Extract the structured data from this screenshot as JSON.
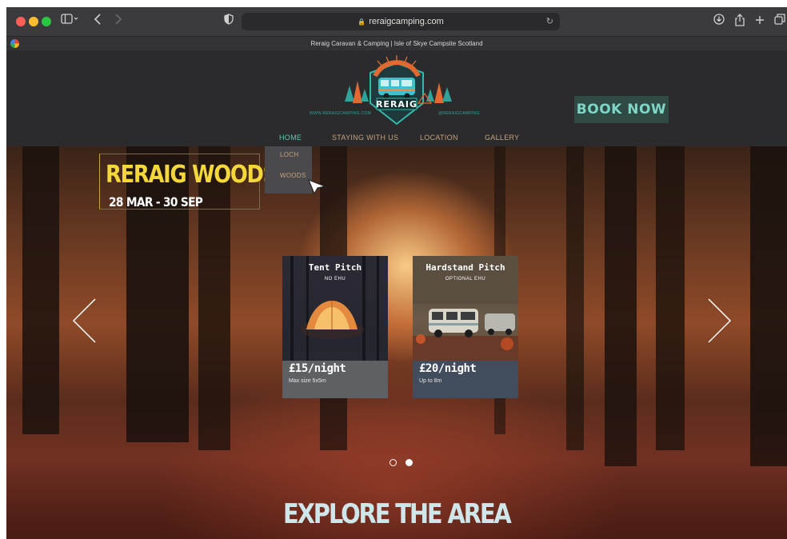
{
  "browser": {
    "url": "reraigcamping.com",
    "tab_title": "Reraig Caravan & Camping | Isle of Skye Campsite Scotland"
  },
  "header": {
    "logo_text": "RERAIG",
    "logo_website": "WWW.RERAIGCAMPING.COM",
    "logo_social": "@RERAIGCAMPING",
    "book_label": "BOOK NOW"
  },
  "nav": {
    "items": [
      "HOME",
      "STAYING WITH US",
      "LOCATION",
      "GALLERY"
    ],
    "active": "HOME",
    "dropdown": [
      "LOCH",
      "WOODS"
    ]
  },
  "hero": {
    "title": "RERAIG WOODS",
    "dates": "28 MAR - 30 SEP",
    "cards": [
      {
        "title": "Tent Pitch",
        "subtitle": "NO EHU",
        "price": "£15/night",
        "note": "Max size 5x5m"
      },
      {
        "title": "Hardstand Pitch",
        "subtitle": "OPTIONAL EHU",
        "price": "£20/night",
        "note": "Up to 8m"
      }
    ],
    "slides_total": 2,
    "slide_active": 2
  },
  "explore_label": "EXPLORE THE AREA",
  "colors": {
    "hero_title": "#f4d83a",
    "book_now_bg": "#2f4a44",
    "book_now_text": "#7fd6c4",
    "nav_active": "#5fcab0",
    "nav_text": "#c4a37e"
  },
  "icons": [
    "sidebar-icon",
    "back-icon",
    "forward-icon",
    "shield-icon",
    "lock-icon",
    "reload-icon",
    "download-icon",
    "share-icon",
    "new-tab-icon",
    "tabs-overview-icon"
  ]
}
